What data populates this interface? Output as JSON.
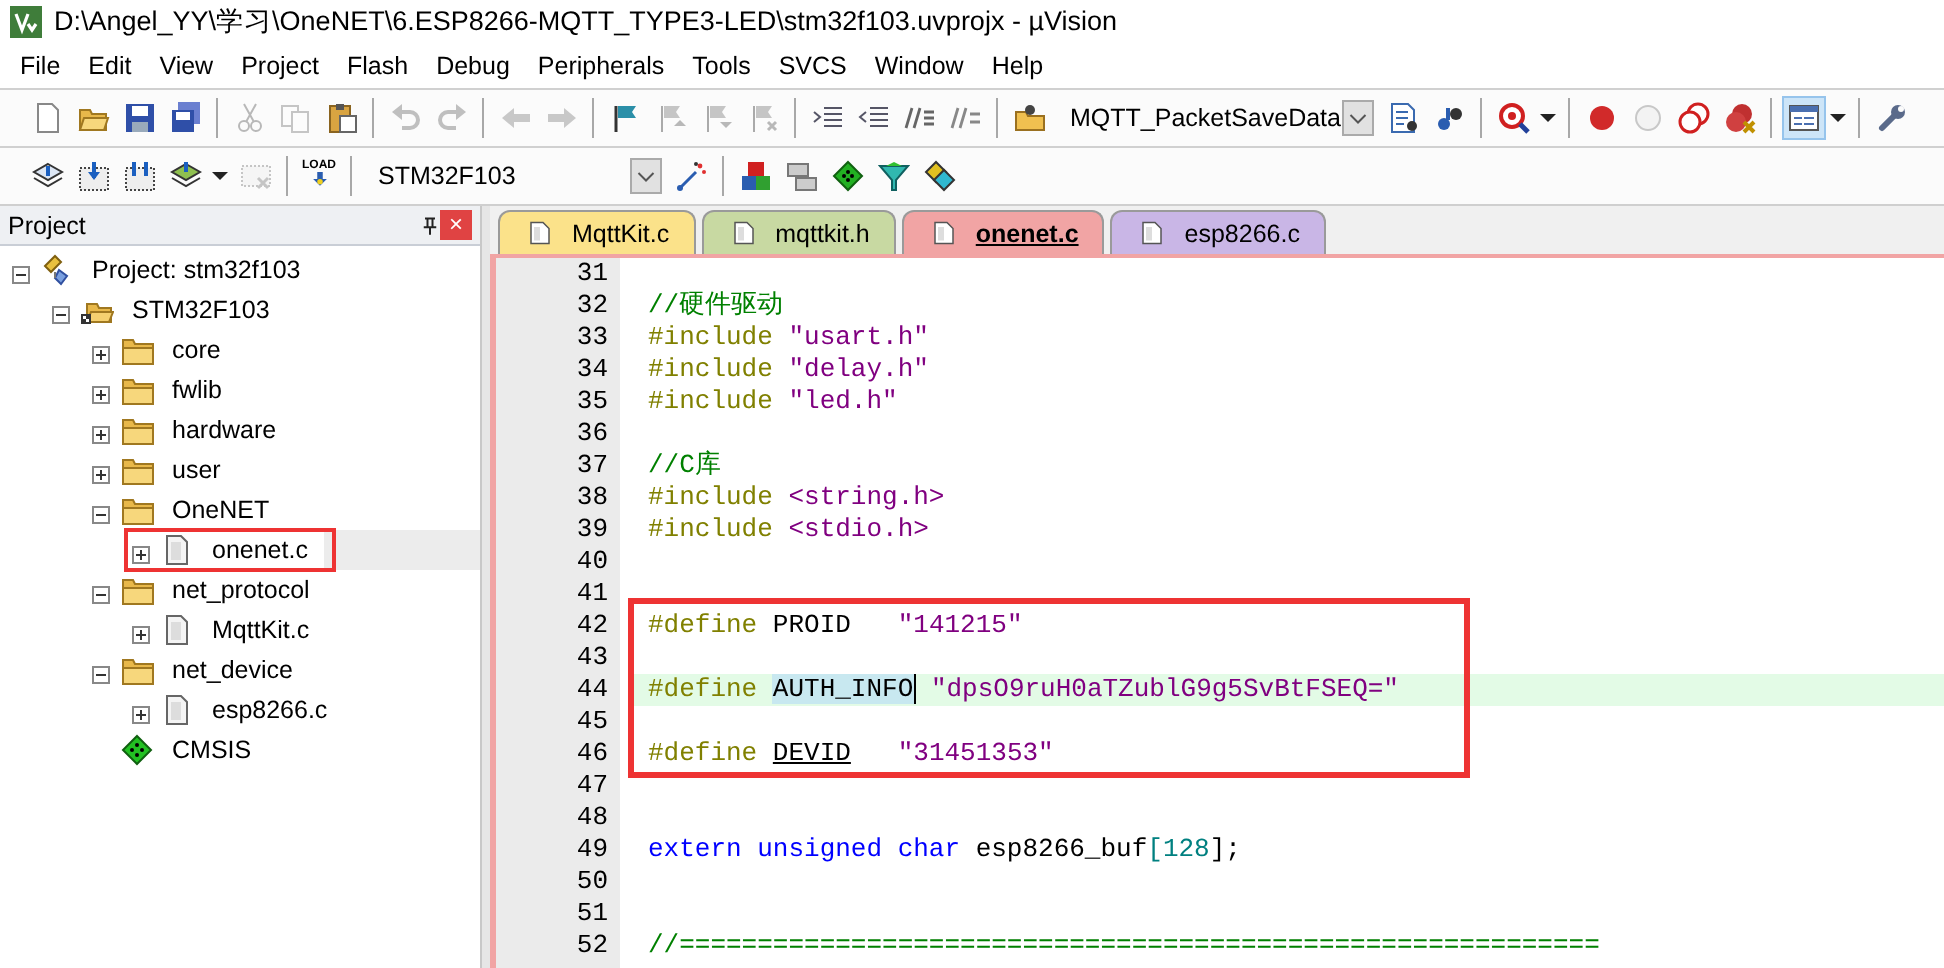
{
  "window": {
    "title": "D:\\Angel_YY\\学习\\OneNET\\6.ESP8266-MQTT_TYPE3-LED\\stm32f103.uvprojx - µVision"
  },
  "menu": [
    "File",
    "Edit",
    "View",
    "Project",
    "Flash",
    "Debug",
    "Peripherals",
    "Tools",
    "SVCS",
    "Window",
    "Help"
  ],
  "toolbars": [
    [
      {
        "kind": "button",
        "disabled": false,
        "pressed": false
      },
      {
        "kind": "button",
        "disabled": false,
        "pressed": false
      },
      {
        "kind": "button",
        "disabled": false,
        "pressed": false
      },
      {
        "kind": "button",
        "disabled": false,
        "pressed": false
      },
      {
        "kind": "separator"
      },
      {
        "kind": "button",
        "disabled": true,
        "pressed": false
      },
      {
        "kind": "button",
        "disabled": true,
        "pressed": false
      },
      {
        "kind": "button",
        "disabled": false,
        "pressed": false
      },
      {
        "kind": "separator"
      },
      {
        "kind": "button",
        "disabled": true,
        "pressed": false
      },
      {
        "kind": "button",
        "disabled": true,
        "pressed": false
      },
      {
        "kind": "separator"
      },
      {
        "kind": "button",
        "disabled": true,
        "pressed": false
      },
      {
        "kind": "button",
        "disabled": true,
        "pressed": false
      },
      {
        "kind": "separator"
      },
      {
        "kind": "button",
        "disabled": false,
        "pressed": false
      },
      {
        "kind": "button",
        "disabled": true,
        "pressed": false
      },
      {
        "kind": "button",
        "disabled": true,
        "pressed": false
      },
      {
        "kind": "button",
        "disabled": true,
        "pressed": false
      },
      {
        "kind": "separator"
      },
      {
        "kind": "button",
        "disabled": false,
        "pressed": false
      },
      {
        "kind": "button",
        "disabled": false,
        "pressed": false
      },
      {
        "kind": "button",
        "disabled": false,
        "pressed": false
      },
      {
        "kind": "button",
        "disabled": false,
        "pressed": false
      },
      {
        "kind": "separator"
      },
      {
        "kind": "button",
        "disabled": false,
        "pressed": false
      },
      {
        "kind": "combo",
        "value": "MQTT_PacketSaveData"
      },
      {
        "kind": "button",
        "disabled": false,
        "pressed": false
      },
      {
        "kind": "button",
        "disabled": false,
        "pressed": false
      },
      {
        "kind": "separator"
      },
      {
        "kind": "button",
        "disabled": false,
        "pressed": false
      },
      {
        "kind": "caret"
      },
      {
        "kind": "separator"
      },
      {
        "kind": "button",
        "disabled": false,
        "pressed": false
      },
      {
        "kind": "button",
        "disabled": false,
        "pressed": false
      },
      {
        "kind": "button",
        "disabled": false,
        "pressed": false
      },
      {
        "kind": "button",
        "disabled": false,
        "pressed": false
      },
      {
        "kind": "separator"
      },
      {
        "kind": "button",
        "disabled": false,
        "pressed": true
      },
      {
        "kind": "caret"
      },
      {
        "kind": "separator"
      },
      {
        "kind": "button",
        "disabled": false,
        "pressed": false
      }
    ],
    [
      {
        "kind": "button",
        "disabled": false,
        "pressed": false
      },
      {
        "kind": "button",
        "disabled": false,
        "pressed": false
      },
      {
        "kind": "button",
        "disabled": false,
        "pressed": false
      },
      {
        "kind": "button",
        "disabled": false,
        "pressed": false
      },
      {
        "kind": "caret"
      },
      {
        "kind": "button",
        "disabled": true,
        "pressed": false
      },
      {
        "kind": "separator"
      },
      {
        "kind": "button",
        "disabled": false,
        "pressed": false,
        "label": "LOAD"
      },
      {
        "kind": "separator"
      },
      {
        "kind": "combo",
        "value": "STM32F103"
      },
      {
        "kind": "button",
        "disabled": false,
        "pressed": false
      },
      {
        "kind": "separator"
      },
      {
        "kind": "button",
        "disabled": false,
        "pressed": false
      },
      {
        "kind": "button",
        "disabled": false,
        "pressed": false
      },
      {
        "kind": "button",
        "disabled": false,
        "pressed": false
      },
      {
        "kind": "button",
        "disabled": false,
        "pressed": false
      },
      {
        "kind": "button",
        "disabled": false,
        "pressed": false
      }
    ]
  ],
  "project_panel": {
    "title": "Project",
    "close": "×",
    "tree": [
      {
        "label": "Project: stm32f103",
        "kind": "project",
        "expanded": true,
        "selected": false,
        "marked": false,
        "children": [
          {
            "label": "STM32F103",
            "kind": "target",
            "expanded": true,
            "selected": false,
            "marked": false,
            "children": [
              {
                "label": "core",
                "kind": "group",
                "expanded": false,
                "selected": false,
                "marked": false
              },
              {
                "label": "fwlib",
                "kind": "group",
                "expanded": false,
                "selected": false,
                "marked": false
              },
              {
                "label": "hardware",
                "kind": "group",
                "expanded": false,
                "selected": false,
                "marked": false
              },
              {
                "label": "user",
                "kind": "group",
                "expanded": false,
                "selected": false,
                "marked": false
              },
              {
                "label": "OneNET",
                "kind": "group",
                "expanded": true,
                "selected": false,
                "marked": false,
                "children": [
                  {
                    "label": "onenet.c",
                    "kind": "file",
                    "expanded": false,
                    "selected": true,
                    "marked": true
                  }
                ]
              },
              {
                "label": "net_protocol",
                "kind": "group",
                "expanded": true,
                "selected": false,
                "marked": false,
                "children": [
                  {
                    "label": "MqttKit.c",
                    "kind": "file",
                    "expanded": false,
                    "selected": false,
                    "marked": false
                  }
                ]
              },
              {
                "label": "net_device",
                "kind": "group",
                "expanded": true,
                "selected": false,
                "marked": false,
                "children": [
                  {
                    "label": "esp8266.c",
                    "kind": "file",
                    "expanded": false,
                    "selected": false,
                    "marked": false
                  }
                ]
              },
              {
                "label": "CMSIS",
                "kind": "component",
                "selected": false,
                "marked": false
              }
            ]
          }
        ]
      }
    ]
  },
  "editor": {
    "tabs": [
      {
        "label": "MqttKit.c",
        "color": "#fbe28a",
        "selected": false
      },
      {
        "label": "mqttkit.h",
        "color": "#c8d9a2",
        "selected": false
      },
      {
        "label": "onenet.c",
        "color": "#f1a4a4",
        "selected": true
      },
      {
        "label": "esp8266.c",
        "color": "#c9b6e6",
        "selected": false
      }
    ],
    "blocks": [
      {
        "boxed": false,
        "lines": [
          {
            "number": "31",
            "current": false
          },
          {
            "number": "32",
            "current": false,
            "tokens": [
              {
                "kind": "comment",
                "text": "//硬件驱动"
              }
            ]
          },
          {
            "number": "33",
            "current": false,
            "tokens": [
              {
                "kind": "preproc",
                "text": "#include "
              },
              {
                "kind": "string",
                "text": "\"usart.h\""
              }
            ]
          },
          {
            "number": "34",
            "current": false,
            "tokens": [
              {
                "kind": "preproc",
                "text": "#include "
              },
              {
                "kind": "string",
                "text": "\"delay.h\""
              }
            ]
          },
          {
            "number": "35",
            "current": false,
            "tokens": [
              {
                "kind": "preproc",
                "text": "#include "
              },
              {
                "kind": "string",
                "text": "\"led.h\""
              }
            ]
          },
          {
            "number": "36",
            "current": false
          },
          {
            "number": "37",
            "current": false,
            "tokens": [
              {
                "kind": "comment",
                "text": "//C库"
              }
            ]
          },
          {
            "number": "38",
            "current": false,
            "tokens": [
              {
                "kind": "preproc",
                "text": "#include "
              },
              {
                "kind": "string",
                "text": "<string.h>"
              }
            ]
          },
          {
            "number": "39",
            "current": false,
            "tokens": [
              {
                "kind": "preproc",
                "text": "#include "
              },
              {
                "kind": "string",
                "text": "<stdio.h>"
              }
            ]
          },
          {
            "number": "40",
            "current": false
          },
          {
            "number": "41",
            "current": false
          }
        ]
      },
      {
        "boxed": true,
        "lines": [
          {
            "number": "42",
            "current": false,
            "tokens": [
              {
                "kind": "preproc",
                "text": "#define "
              },
              {
                "kind": "plain",
                "text": "PROID   "
              },
              {
                "kind": "string",
                "text": "\"141215\""
              }
            ]
          },
          {
            "number": "43",
            "current": false
          },
          {
            "number": "44",
            "current": true,
            "tokens": [
              {
                "kind": "preproc",
                "text": "#define "
              },
              {
                "kind": "marked",
                "text": "AUTH_INFO"
              },
              {
                "kind": "caret"
              },
              {
                "kind": "string",
                "text": " \"dpsO9ruH0aTZublG9g5SvBtFSEQ=\""
              }
            ]
          },
          {
            "number": "45",
            "current": false
          },
          {
            "number": "46",
            "current": false,
            "tokens": [
              {
                "kind": "preproc",
                "text": "#define "
              },
              {
                "kind": "underlined",
                "text": "DEVID"
              },
              {
                "kind": "string",
                "text": "   \"31451353\""
              }
            ]
          }
        ]
      },
      {
        "boxed": false,
        "lines": [
          {
            "number": "47",
            "current": false
          },
          {
            "number": "48",
            "current": false
          },
          {
            "number": "49",
            "current": false,
            "tokens": [
              {
                "kind": "keyword",
                "text": "extern unsigned char "
              },
              {
                "kind": "plain",
                "text": "esp8266_buf"
              },
              {
                "kind": "number",
                "text": "[128"
              },
              {
                "kind": "plain",
                "text": "];"
              }
            ]
          },
          {
            "number": "50",
            "current": false
          },
          {
            "number": "51",
            "current": false
          },
          {
            "number": "52",
            "current": false,
            "tokens": [
              {
                "kind": "comment",
                "text": "//==========================================================="
              }
            ]
          }
        ]
      }
    ]
  }
}
